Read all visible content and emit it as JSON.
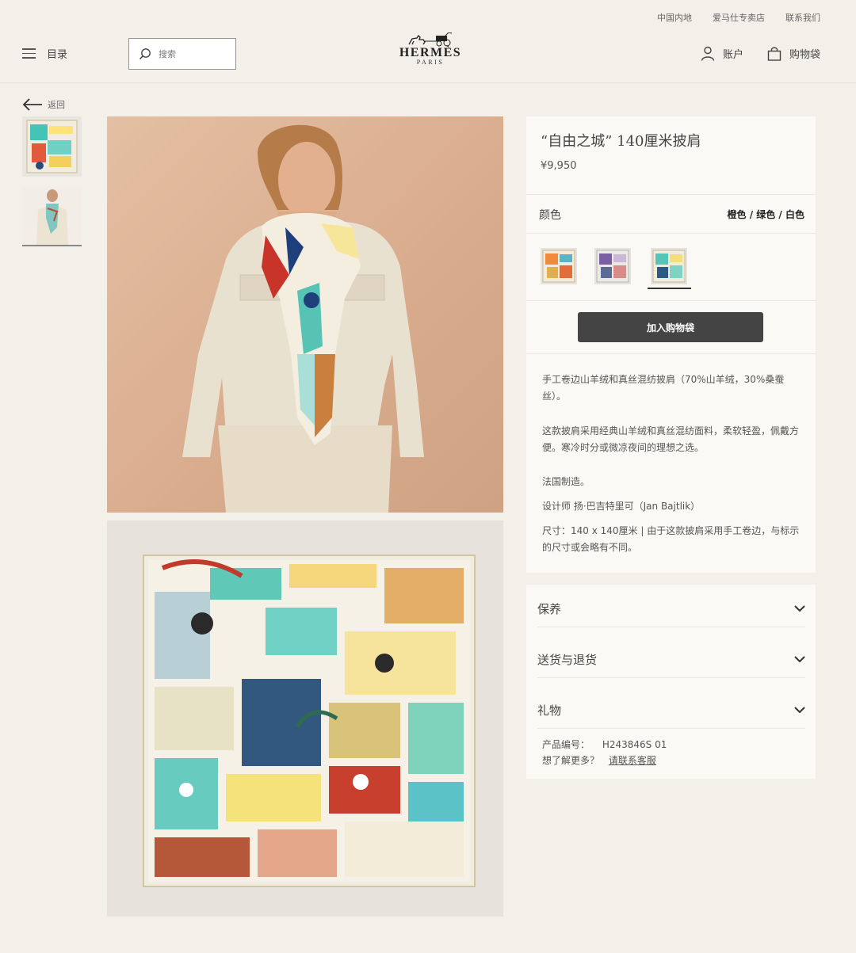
{
  "header": {
    "util_links": [
      "中国内地",
      "爱马仕专卖店",
      "联系我们"
    ],
    "menu_label": "目录",
    "search_placeholder": "搜索",
    "logo_text": "HERMÈS",
    "logo_city": "PARIS",
    "account_label": "账户",
    "bag_label": "购物袋"
  },
  "nav": {
    "back_label": "返回"
  },
  "product": {
    "title": "“自由之城” 140厘米披肩",
    "price": "¥9,950",
    "color_label": "颜色",
    "color_value": "橙色 / 绿色 / 白色",
    "swatches": [
      "orange-variant",
      "purple-variant",
      "green-variant"
    ],
    "selected_swatch": 3,
    "add_to_bag": "加入购物袋",
    "description_1": "手工卷边山羊绒和真丝混纺披肩（70%山羊绒，30%桑蚕丝）。",
    "description_2": "这款披肩采用经典山羊绒和真丝混纺面料，柔软轻盈，佩戴方便。寒冷时分或微凉夜间的理想之选。",
    "made_in": "法国制造。",
    "designer": "设计师 扬·巴吉特里可（Jan Bajtlik）",
    "size": "尺寸：140 x 140厘米 | 由于这款披肩采用手工卷边，与标示的尺寸或会略有不同。"
  },
  "accordion": {
    "items": [
      "保养",
      "送货与退货",
      "礼物"
    ],
    "ref_label": "产品编号：",
    "ref_value": "H243846S 01",
    "more_label": "想了解更多？",
    "contact_link": "请联系客服"
  },
  "colors": {
    "background": "#f3efe9",
    "card": "#fbf9f6",
    "button": "#444444",
    "hero_bg": "#d9ab8d"
  }
}
